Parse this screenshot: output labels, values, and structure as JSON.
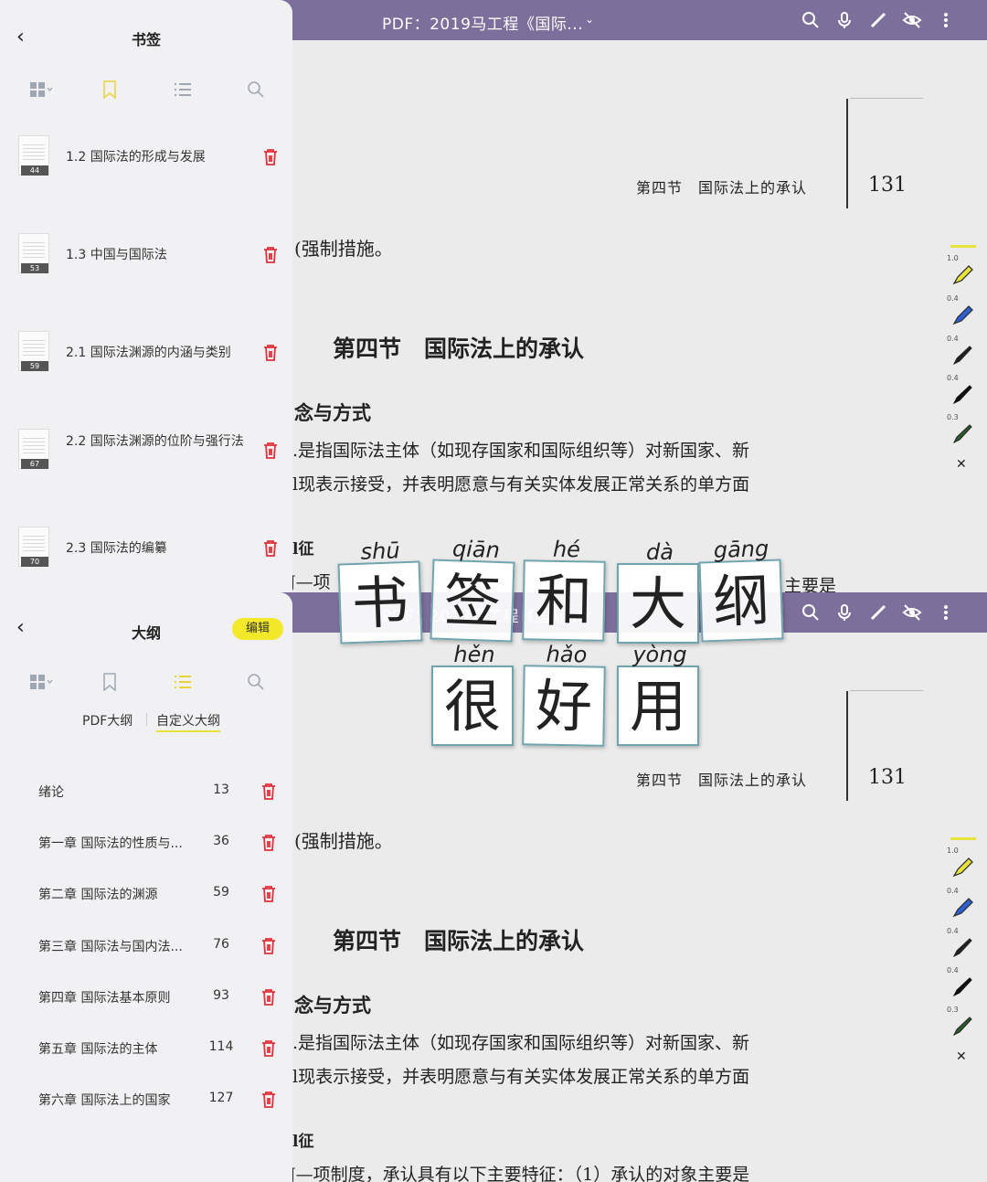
{
  "reader": {
    "title": "PDF：2019马工程《国际...",
    "page_header": "第四节　国际法上的承认",
    "page_number": "131",
    "line1": "(强制措施。",
    "section_title": "第四节　国际法上的承认",
    "subsection": "念与方式",
    "para1": ".是指国际法主体（如现存国家和国际组织等）对新国家、新",
    "para2": "l现表示接受，并表明愿意与有关实体发展正常关系的单方面",
    "sub2": "l征",
    "para3_top": "J—项",
    "para3_top_tail": "主要是",
    "para3_full": "J—项制度，承认具有以下主要特征：（1）承认的对象主要是",
    "pen_widths": [
      "1.0",
      "0.4",
      "0.4",
      "0.4",
      "0.3"
    ]
  },
  "bookmarks": {
    "title": "书签",
    "items": [
      {
        "label": "1.2 国际法的形成与发展",
        "page": "44"
      },
      {
        "label": "1.3 中国与国际法",
        "page": "53"
      },
      {
        "label": "2.1 国际法渊源的内涵与类别",
        "page": "59"
      },
      {
        "label": "2.2 国际法渊源的位阶与强行法",
        "page": "67"
      },
      {
        "label": "2.3 国际法的编纂",
        "page": "70"
      }
    ]
  },
  "outline": {
    "title": "大纲",
    "edit_label": "编辑",
    "tab_pdf": "PDF大纲",
    "tab_custom": "自定义大纲",
    "items": [
      {
        "label": "绪论",
        "page": "13"
      },
      {
        "label": "第一章 国际法的性质与...",
        "page": "36"
      },
      {
        "label": "第二章 国际法的渊源",
        "page": "59"
      },
      {
        "label": "第三章 国际法与国内法...",
        "page": "76"
      },
      {
        "label": "第四章 国际法基本原则",
        "page": "93"
      },
      {
        "label": "第五章 国际法的主体",
        "page": "114"
      },
      {
        "label": "第六章 国际法上的国家",
        "page": "127"
      }
    ]
  },
  "overlay": {
    "row1": [
      {
        "pinyin": "shū",
        "char": "书"
      },
      {
        "pinyin": "qiān",
        "char": "签"
      },
      {
        "pinyin": "hé",
        "char": "和"
      },
      {
        "pinyin": "dà",
        "char": "大"
      },
      {
        "pinyin": "gāng",
        "char": "纲"
      }
    ],
    "row2": [
      {
        "pinyin": "hěn",
        "char": "很"
      },
      {
        "pinyin": "hǎo",
        "char": "好"
      },
      {
        "pinyin": "yòng",
        "char": "用"
      }
    ]
  },
  "colors": {
    "topbar": "#7d6f9c",
    "accent_yellow": "#f3e92a",
    "trash_red": "#e0313c",
    "cell_border": "#6fa3ad"
  }
}
